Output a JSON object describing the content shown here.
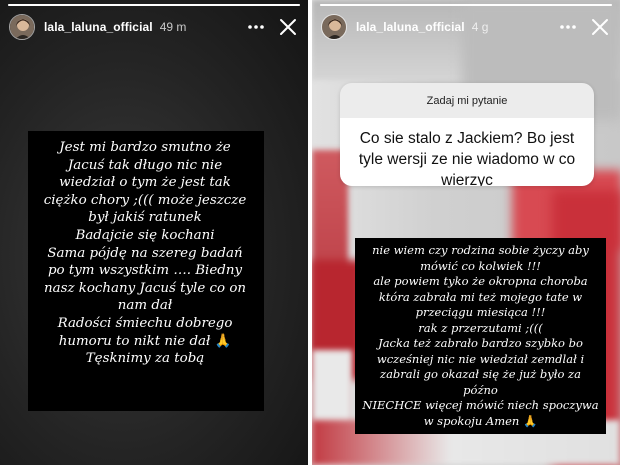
{
  "stories": [
    {
      "username": "lala_laluna_official",
      "time": "49 m",
      "progress": 1.0,
      "text_lines": [
        "Jest mi bardzo smutno  że",
        "Jacuś tak długo nic nie",
        "wiedział o tym że jest tak",
        "ciężko chory ;((( może jeszcze",
        "był jakiś ratunek",
        "Badajcie się kochani",
        "Sama pójdę na szereg badań",
        "po tym wszystkim  …. Biedny",
        "nasz kochany Jacuś tyle co on",
        "nam dał",
        "Radości śmiechu dobrego",
        "humoru to nikt nie dał",
        "Tęsknimy za tobą"
      ],
      "emoji": "🙏"
    },
    {
      "username": "lala_laluna_official",
      "time": "4 g",
      "progress": 1.0,
      "question_header": "Zadaj mi pytanie",
      "question_text": "Co sie stalo z Jackiem? Bo jest tyle wersji ze nie wiadomo w co wierzyc",
      "answer_lines": [
        "nie wiem czy rodzina sobie życzy aby",
        "mówić co kolwiek !!!",
        "ale  powiem tyko że okropna choroba",
        "która zabrała mi też mojego tate w",
        "przeciągu miesiąca !!!",
        "rak z przerzutami ;(((",
        "Jacka też zabrało bardzo szybko bo",
        "wcześniej nic nie wiedział zemdlał i",
        "zabrali go okazał się że już było za późno",
        "NIECHCE więcej mówić niech spoczywa",
        "w spokoju  Amen"
      ],
      "emoji": "🙏"
    }
  ],
  "icons": {
    "more": "more-horizontal-icon",
    "close": "close-icon"
  },
  "colors": {
    "mosaic_red": "#b0242e",
    "mosaic_white": "#ececec"
  }
}
